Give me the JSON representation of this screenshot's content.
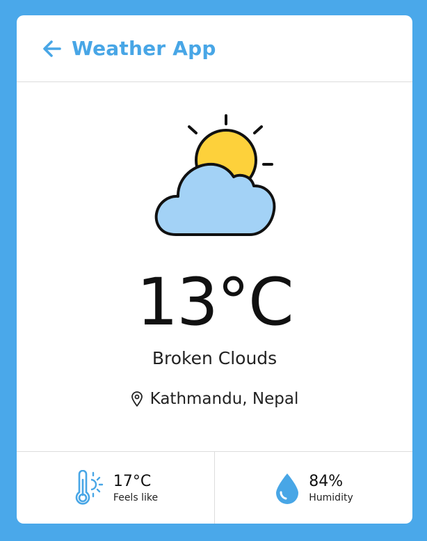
{
  "app": {
    "title": "Weather App"
  },
  "weather": {
    "temperature": "13°C",
    "description": "Broken Clouds",
    "location": "Kathmandu, Nepal"
  },
  "stats": {
    "feels_like_value": "17°C",
    "feels_like_label": "Feels like",
    "humidity_value": "84%",
    "humidity_label": "Humidity"
  },
  "icons": {
    "back": "arrow-left-icon",
    "weather": "partly-cloudy-icon",
    "location": "location-pin-icon",
    "feels_like": "thermometer-icon",
    "humidity": "water-drop-icon"
  },
  "colors": {
    "background": "#4aa8ea",
    "accent": "#48a6e6",
    "sun": "#fdd13b",
    "cloud": "#a3d2f6"
  }
}
